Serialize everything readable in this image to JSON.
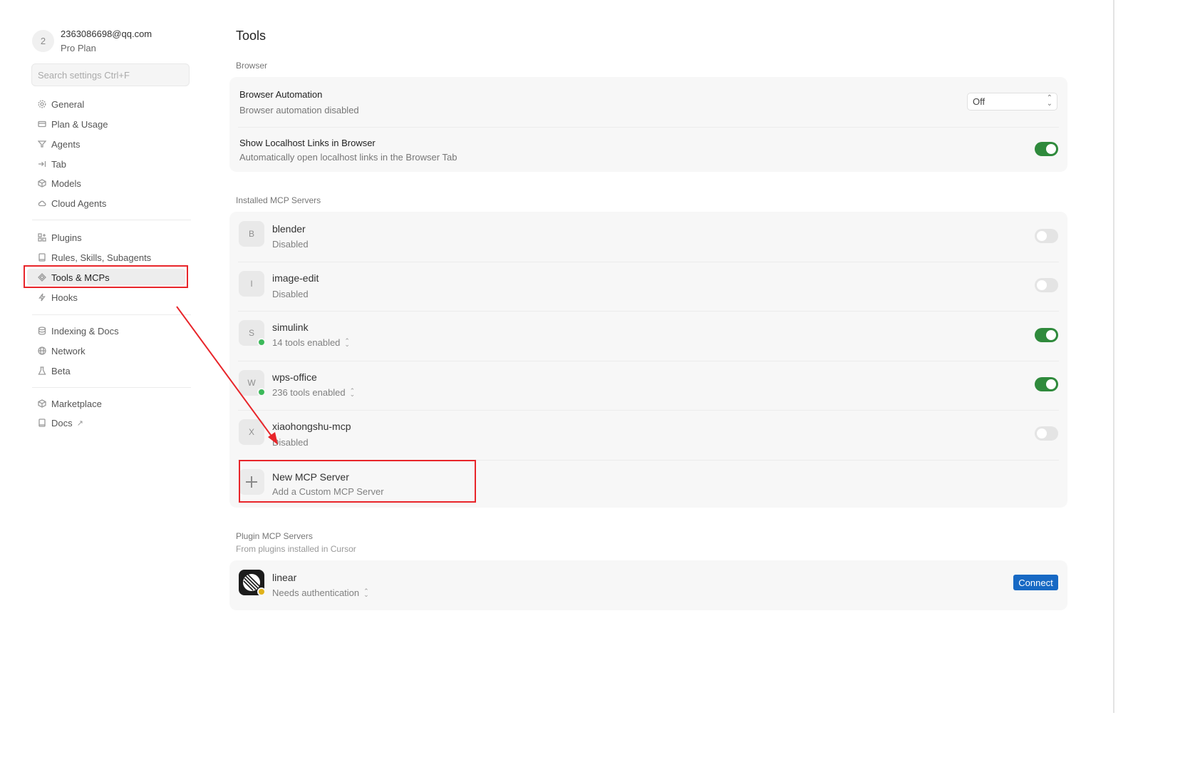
{
  "account": {
    "avatar_letter": "2",
    "email": "2363086698@qq.com",
    "plan": "Pro Plan"
  },
  "search": {
    "placeholder": "Search settings Ctrl+F"
  },
  "sidebar": {
    "group1": [
      {
        "label": "General",
        "icon": "gear-icon"
      },
      {
        "label": "Plan & Usage",
        "icon": "card-icon"
      },
      {
        "label": "Agents",
        "icon": "infinity-icon"
      },
      {
        "label": "Tab",
        "icon": "tab-arrow-icon"
      },
      {
        "label": "Models",
        "icon": "cube-icon"
      },
      {
        "label": "Cloud Agents",
        "icon": "cloud-icon"
      }
    ],
    "group2": [
      {
        "label": "Plugins",
        "icon": "grid-plus-icon"
      },
      {
        "label": "Rules, Skills, Subagents",
        "icon": "book-icon"
      },
      {
        "label": "Tools & MCPs",
        "icon": "tools-icon"
      },
      {
        "label": "Hooks",
        "icon": "bolt-icon"
      }
    ],
    "group3": [
      {
        "label": "Indexing & Docs",
        "icon": "database-icon"
      },
      {
        "label": "Network",
        "icon": "globe-icon"
      },
      {
        "label": "Beta",
        "icon": "flask-icon"
      }
    ],
    "group4": [
      {
        "label": "Marketplace",
        "icon": "cube-icon"
      },
      {
        "label": "Docs",
        "icon": "book-icon",
        "external": "↗"
      }
    ],
    "active": "Tools & MCPs"
  },
  "main": {
    "title": "Tools",
    "browser": {
      "label": "Browser",
      "automation": {
        "title": "Browser Automation",
        "subtitle": "Browser automation disabled",
        "value": "Off"
      },
      "localhost": {
        "title": "Show Localhost Links in Browser",
        "subtitle": "Automatically open localhost links in the Browser Tab",
        "enabled": true
      }
    },
    "installed": {
      "label": "Installed MCP Servers",
      "servers": [
        {
          "letter": "B",
          "name": "blender",
          "status": "Disabled",
          "enabled": false,
          "dot": ""
        },
        {
          "letter": "I",
          "name": "image-edit",
          "status": "Disabled",
          "enabled": false,
          "dot": ""
        },
        {
          "letter": "S",
          "name": "simulink",
          "status": "14 tools enabled",
          "enabled": true,
          "dot": "green"
        },
        {
          "letter": "W",
          "name": "wps-office",
          "status": "236 tools enabled",
          "enabled": true,
          "dot": "green"
        },
        {
          "letter": "X",
          "name": "xiaohongshu-mcp",
          "status": "Disabled",
          "enabled": false,
          "dot": ""
        }
      ],
      "new_server": {
        "title": "New MCP Server",
        "subtitle": "Add a Custom MCP Server"
      }
    },
    "plugin": {
      "label": "Plugin MCP Servers",
      "sublabel": "From plugins installed in Cursor",
      "server": {
        "name": "linear",
        "status": "Needs authentication",
        "button": "Connect"
      }
    }
  },
  "colors": {
    "annotation": "#e8252a",
    "toggle_on": "#2f8a3c",
    "connect": "#1769c4"
  }
}
